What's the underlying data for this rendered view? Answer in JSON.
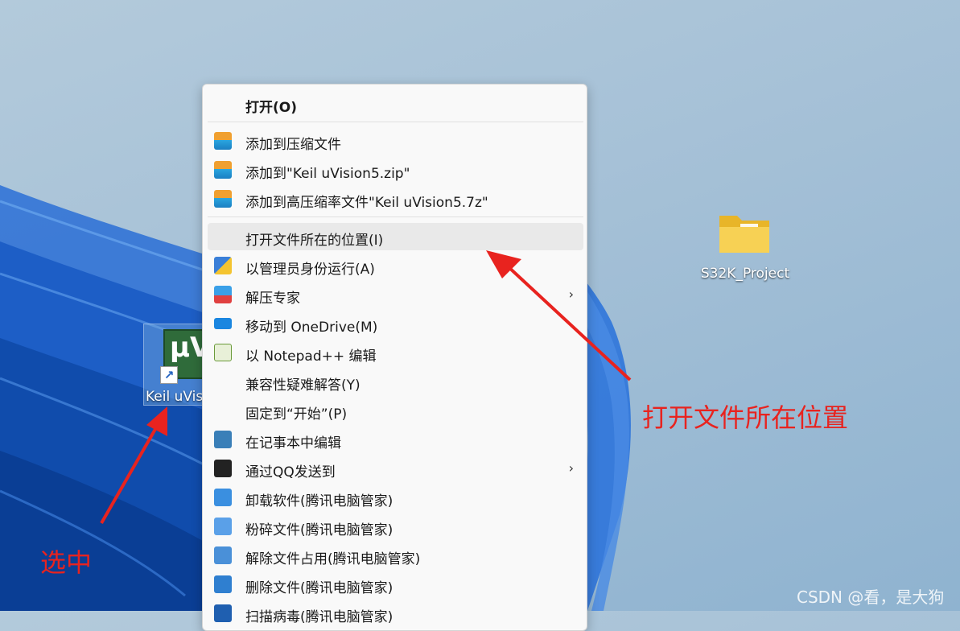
{
  "desktop": {
    "shortcut": {
      "label": "Keil uVis",
      "icon": "keil-uvision-icon"
    },
    "folder": {
      "label": "S32K_Project",
      "icon": "folder-icon"
    }
  },
  "context_menu": {
    "items": [
      {
        "label": "打开(O)",
        "icon": "",
        "bold": true
      },
      {
        "label": "添加到压缩文件",
        "icon": "archive-icon"
      },
      {
        "label": "添加到\"Keil uVision5.zip\"",
        "icon": "archive-icon"
      },
      {
        "label": "添加到高压缩率文件\"Keil uVision5.7z\"",
        "icon": "archive-icon"
      },
      {
        "label": "打开文件所在的位置(I)",
        "icon": "",
        "highlighted": true
      },
      {
        "label": "以管理员身份运行(A)",
        "icon": "uac-shield-icon"
      },
      {
        "label": "解压专家",
        "icon": "uzip-icon",
        "submenu": true
      },
      {
        "label": "移动到 OneDrive(M)",
        "icon": "onedrive-cloud-icon"
      },
      {
        "label": "以 Notepad++ 编辑",
        "icon": "notepad-plus-plus-icon"
      },
      {
        "label": "兼容性疑难解答(Y)",
        "icon": ""
      },
      {
        "label": "固定到“开始”(P)",
        "icon": ""
      },
      {
        "label": "在记事本中编辑",
        "icon": "notepad-icon"
      },
      {
        "label": "通过QQ发送到",
        "icon": "qq-penguin-icon",
        "submenu": true
      },
      {
        "label": "卸载软件(腾讯电脑管家)",
        "icon": "trash-icon"
      },
      {
        "label": "粉碎文件(腾讯电脑管家)",
        "icon": "shredder-icon"
      },
      {
        "label": "解除文件占用(腾讯电脑管家)",
        "icon": "unlock-icon"
      },
      {
        "label": "删除文件(腾讯电脑管家)",
        "icon": "delete-icon"
      },
      {
        "label": "扫描病毒(腾讯电脑管家)",
        "icon": "scan-icon"
      }
    ],
    "submenu_glyph": "›"
  },
  "annotations": {
    "open_location": "打开文件所在位置",
    "select": "选中",
    "color": "#e8231f"
  },
  "watermark": "CSDN @看，是大狗"
}
